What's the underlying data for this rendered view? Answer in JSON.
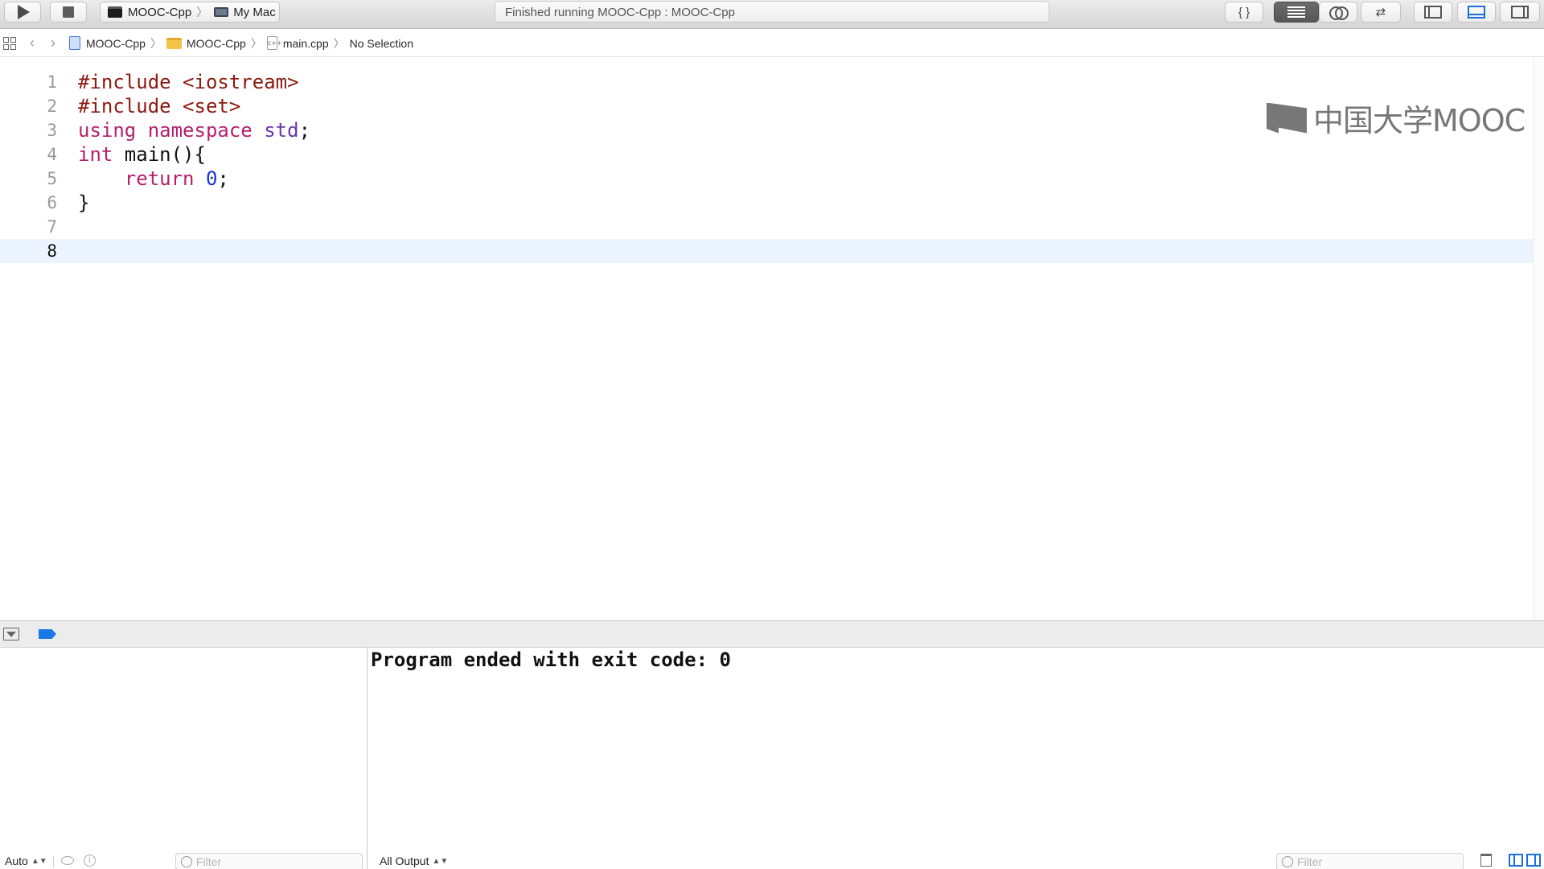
{
  "toolbar": {
    "scheme_name": "MOOC-Cpp",
    "destination": "My Mac",
    "status_text": "Finished running MOOC-Cpp : MOOC-Cpp",
    "editor_standard_label": "{ }",
    "version_editor_label": "⇄"
  },
  "jumpbar": {
    "crumbs": [
      "MOOC-Cpp",
      "MOOC-Cpp",
      "main.cpp",
      "No Selection"
    ],
    "cpp_glyph": "c++"
  },
  "editor": {
    "line_numbers": [
      "1",
      "2",
      "3",
      "4",
      "5",
      "6",
      "7",
      "8"
    ],
    "current_line": 8,
    "lines": {
      "l1": [
        "#include <iostream>"
      ],
      "l2": [
        "#include <set>"
      ],
      "l3": [
        "using",
        " ",
        "namespace",
        " ",
        "std",
        ";"
      ],
      "l4": [
        "int",
        " main(){"
      ],
      "l5": [
        "    ",
        "return",
        " ",
        "0",
        ";"
      ],
      "l6": [
        "}"
      ]
    },
    "colors": {
      "preprocessor": "#8b1a10",
      "keyword": "#b5206d",
      "namespace": "#6c35a8",
      "number": "#1a31d6",
      "current_line_bg": "#ecf5ff"
    }
  },
  "watermark": {
    "text": "中国大学MOOC"
  },
  "console": {
    "output": "Program ended with exit code: 0",
    "output_selector": "All Output",
    "filter_placeholder": "Filter"
  },
  "variables": {
    "mode": "Auto",
    "filter_placeholder": "Filter"
  },
  "icons": {
    "run": "play-icon",
    "stop": "stop-icon",
    "debug_tag": "breakpoint-tag-icon",
    "trash": "trash-icon"
  }
}
